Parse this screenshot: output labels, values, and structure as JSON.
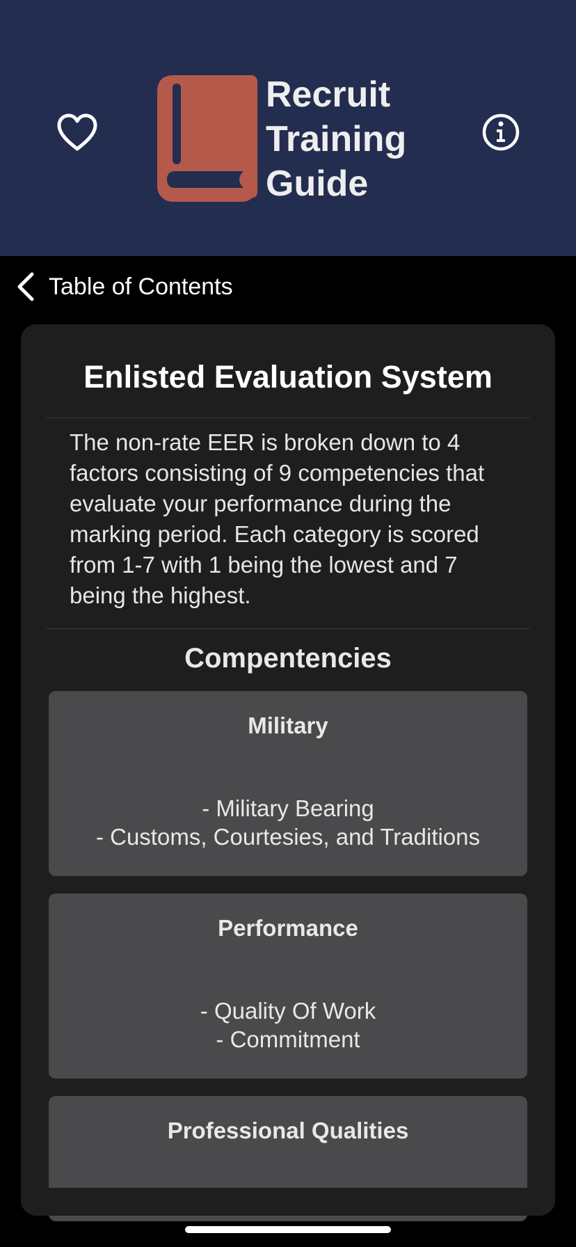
{
  "header": {
    "title_lines": [
      "Recruit",
      "Training",
      "Guide"
    ],
    "logo_icon": "book-icon",
    "logo_color": "#b5594a",
    "background": "#232d4f",
    "favorite_icon": "heart-icon",
    "info_icon": "info-icon"
  },
  "nav": {
    "back_label": "Table of Contents",
    "back_icon": "chevron-left-icon"
  },
  "content": {
    "title": "Enlisted Evaluation System",
    "intro": "The non-rate EER is broken down to 4 factors consisting of 9 competencies that evaluate your performance during the marking period. Each category is scored from 1-7 with 1 being the lowest and 7 being the highest.",
    "section_heading": "Compentencies",
    "competencies": [
      {
        "name": "Military",
        "items": [
          "- Military Bearing",
          "- Customs, Courtesies, and Traditions"
        ]
      },
      {
        "name": "Performance",
        "items": [
          "- Quality Of Work",
          "- Commitment"
        ]
      },
      {
        "name": "Professional Qualities",
        "items": []
      }
    ]
  }
}
